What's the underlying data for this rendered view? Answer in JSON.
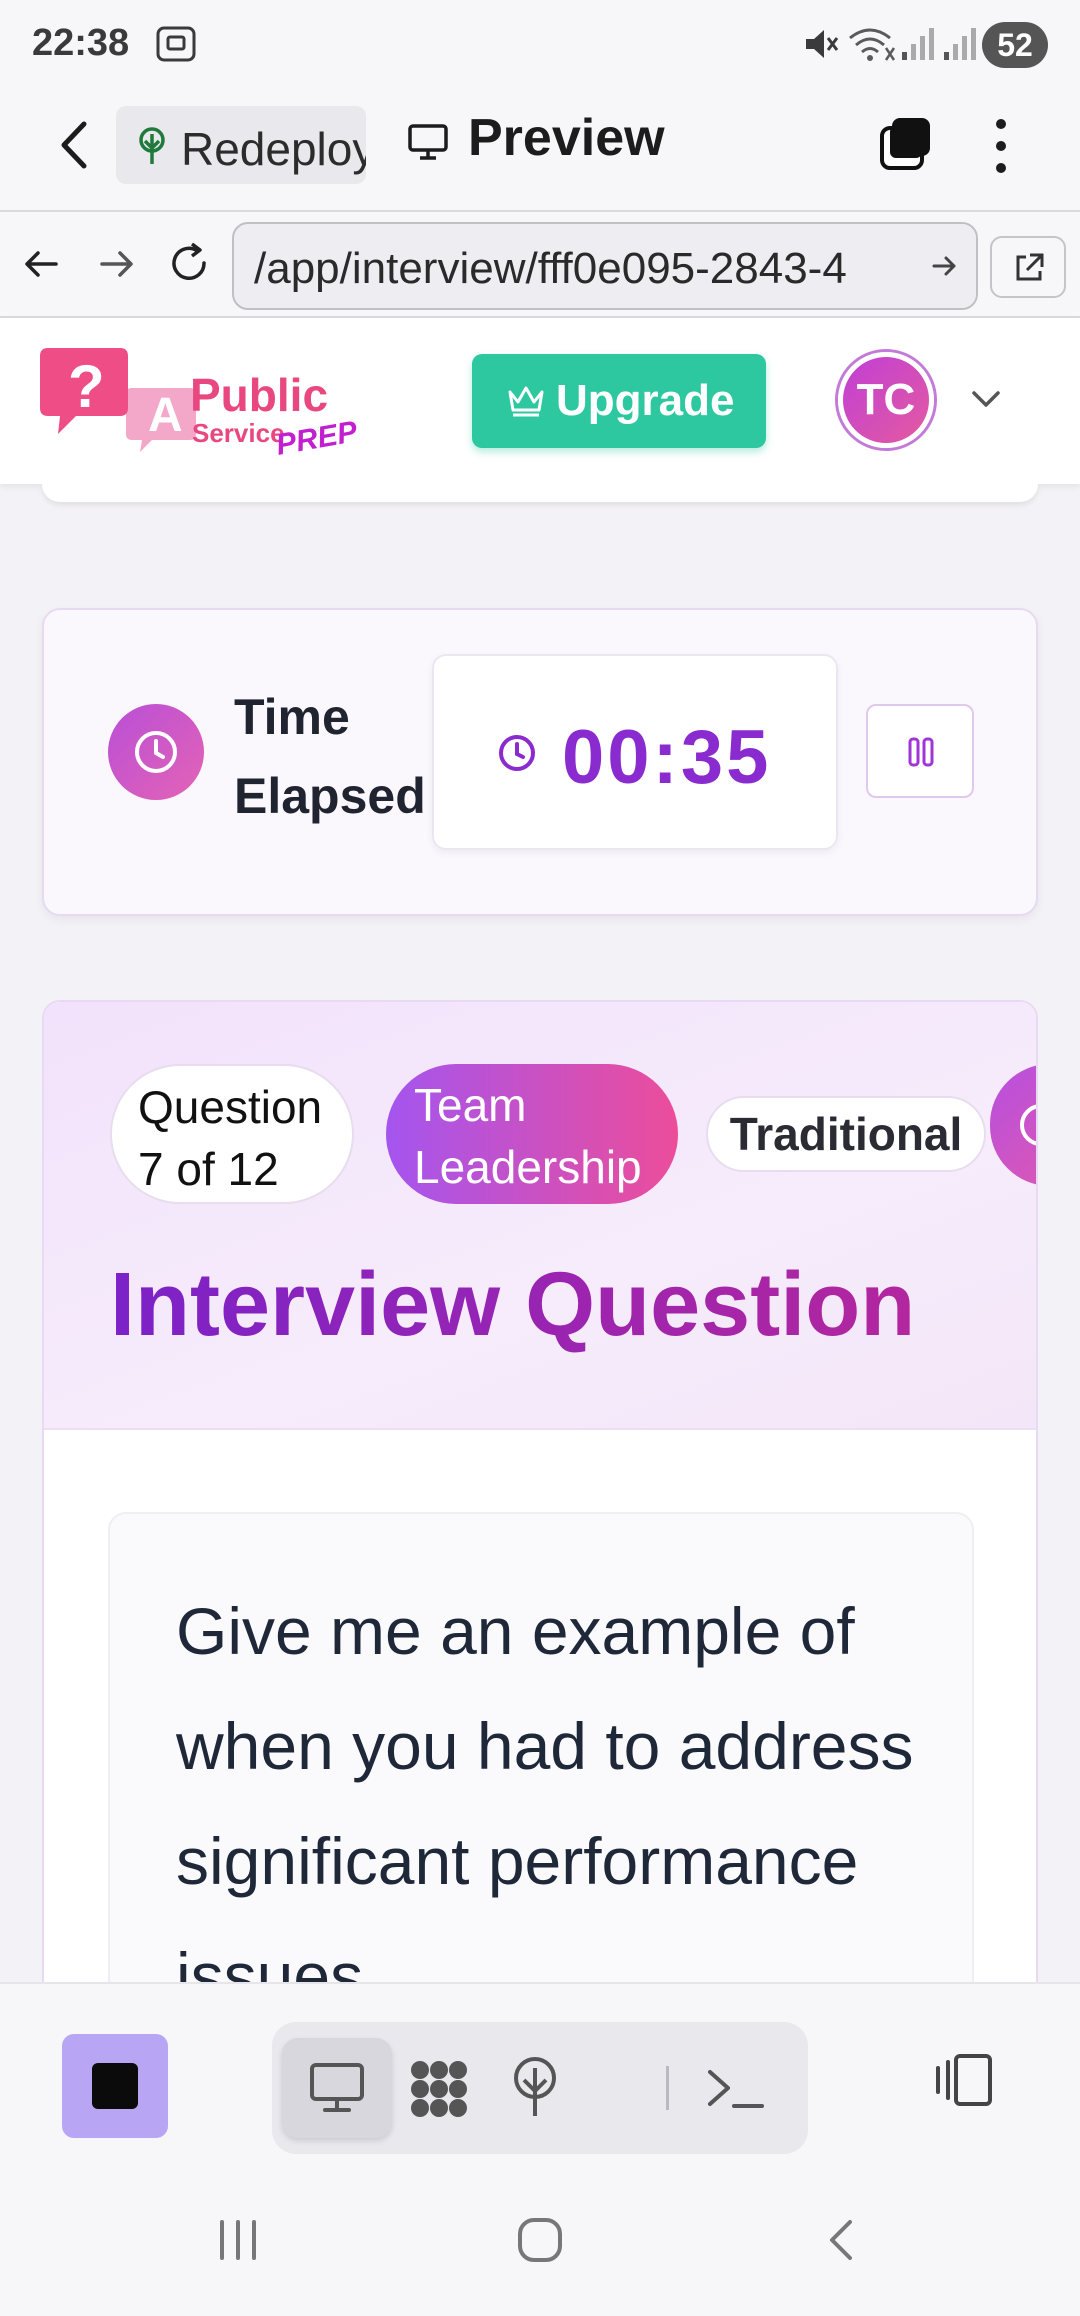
{
  "status_bar": {
    "time": "22:38",
    "battery": "52",
    "icons": [
      "screenshot-icon",
      "mute-icon",
      "wifi-icon",
      "signal-icon",
      "signal-icon"
    ]
  },
  "replit_header": {
    "repl_name": "Redeploy",
    "tab_title": "Preview",
    "icons": [
      "back-arrow-icon",
      "deploy-tree-icon",
      "monitor-icon",
      "tabs-icon",
      "more-vertical-icon"
    ]
  },
  "url_bar": {
    "url": "/app/interview/fff0e095-2843-4",
    "icons": [
      "nav-back-icon",
      "nav-forward-icon",
      "reload-icon",
      "go-arrow-icon",
      "open-external-icon"
    ]
  },
  "site_header": {
    "logo": {
      "word1": "Public",
      "word2": "Service",
      "word3": "PREP",
      "badge_q": "?",
      "badge_a": "A"
    },
    "upgrade_label": "Upgrade",
    "avatar_initials": "TC",
    "colors": {
      "upgrade": "#2ec8a0",
      "brand_pink": "#e8487f",
      "brand_purple": "#8a2bd0"
    }
  },
  "timer": {
    "label": "Time Elapsed",
    "value": "00:35"
  },
  "question": {
    "counter": "Question 7 of 12",
    "category": "Team Leadership",
    "type": "Traditional",
    "heading": "Interview Question",
    "text": "Give me an example of when you had to address significant performance issues"
  },
  "bottom_toolbar": {
    "tools": [
      "desktop-preview-icon",
      "workspace-grid-icon",
      "deploy-icon",
      "shell-icon",
      "panel-toggle-icon"
    ],
    "active_tool": "desktop-preview-icon"
  },
  "nav_bar": {
    "buttons": [
      "recents-icon",
      "home-icon",
      "back-icon"
    ]
  }
}
